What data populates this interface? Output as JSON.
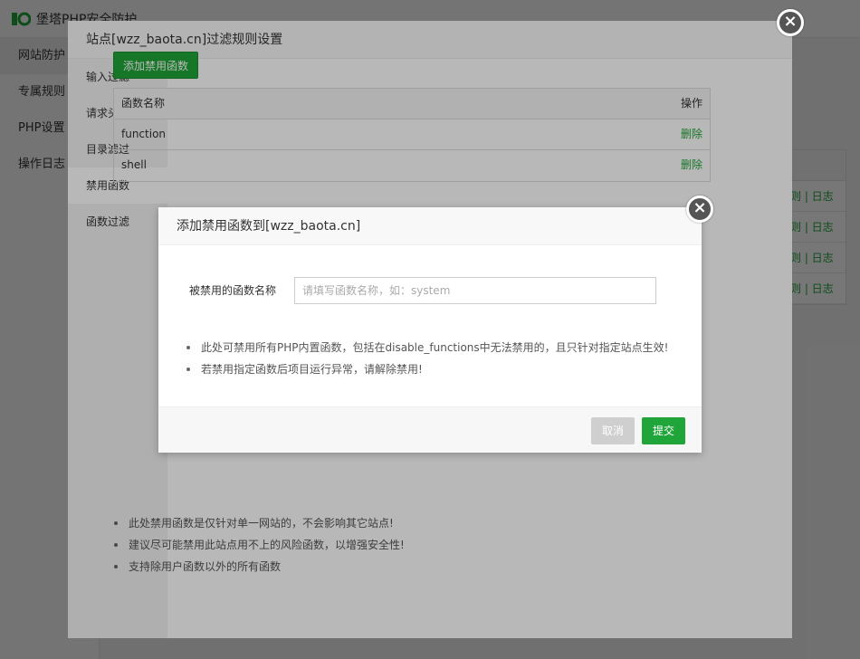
{
  "app": {
    "title": "堡塔PHP安全防护",
    "sidebar": [
      "网站防护",
      "专属规则",
      "PHP设置",
      "操作日志"
    ],
    "bg_table_links": [
      "则 | 日志",
      "则 | 日志",
      "则 | 日志",
      "则 | 日志"
    ]
  },
  "outer_modal": {
    "title": "站点[wzz_baota.cn]过滤规则设置",
    "close_icon": "×",
    "nav": [
      "输入过滤",
      "请求头过滤",
      "目录滤过",
      "禁用函数",
      "函数过滤"
    ],
    "add_button": "添加禁用函数",
    "table": {
      "headers": [
        "函数名称",
        "操作"
      ],
      "rows": [
        {
          "name": "function",
          "action": "删除"
        },
        {
          "name": "shell",
          "action": "删除"
        }
      ]
    },
    "notes": [
      "此处禁用函数是仅针对单一网站的，不会影响其它站点!",
      "建议尽可能禁用此站点用不上的风险函数，以增强安全性!",
      "支持除用户函数以外的所有函数"
    ]
  },
  "inner_modal": {
    "title": "添加禁用函数到[wzz_baota.cn]",
    "close_icon": "×",
    "field_label": "被禁用的函数名称",
    "field_placeholder": "请填写函数名称，如：system",
    "field_value": "",
    "notes": [
      "此处可禁用所有PHP内置函数，包括在disable_functions中无法禁用的，且只针对指定站点生效!",
      "若禁用指定函数后项目运行异常，请解除禁用!"
    ],
    "cancel_label": "取消",
    "submit_label": "提交"
  },
  "colors": {
    "accent": "#20a53a",
    "cancel": "#cfcfcf"
  }
}
